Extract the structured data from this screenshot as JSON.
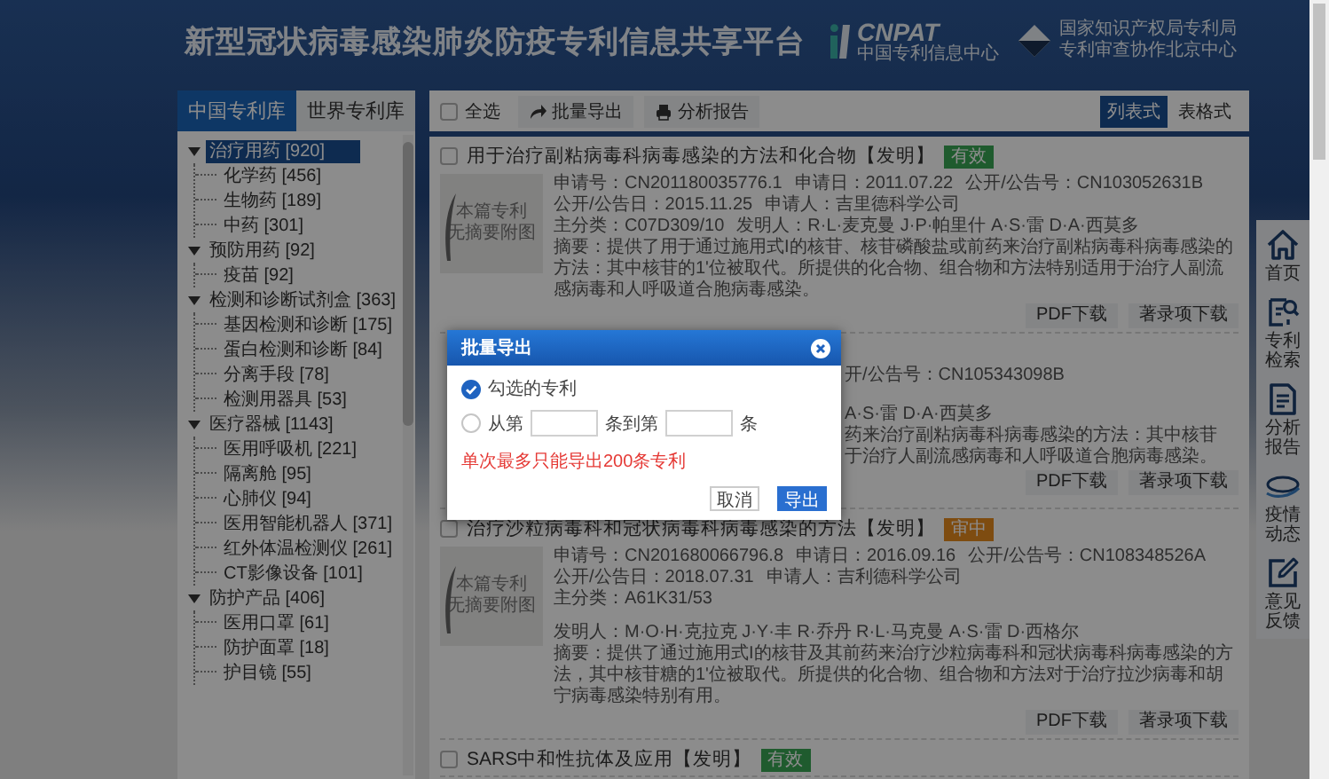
{
  "header": {
    "title": "新型冠状病毒感染肺炎防疫专利信息共享平台",
    "logos": [
      {
        "kind": "cnpat",
        "lines": [
          "CNPAT",
          "中国专利信息中心"
        ]
      },
      {
        "kind": "diamond",
        "lines": [
          "国家知识产权局专利局",
          "专利审查协作北京中心"
        ]
      }
    ]
  },
  "database_tabs": [
    {
      "label": "中国专利库",
      "selected": true
    },
    {
      "label": "世界专利库",
      "selected": false
    }
  ],
  "category_tree": [
    {
      "label": "治疗用药 [920]",
      "selected": true,
      "expanded": true,
      "children": [
        {
          "label": "化学药 [456]",
          "selected": false
        },
        {
          "label": "生物药 [189]",
          "selected": false
        },
        {
          "label": "中药 [301]",
          "selected": false
        }
      ]
    },
    {
      "label": "预防用药 [92]",
      "selected": false,
      "expanded": true,
      "children": [
        {
          "label": "疫苗 [92]",
          "selected": false
        }
      ]
    },
    {
      "label": "检测和诊断试剂盒 [363]",
      "selected": false,
      "expanded": true,
      "children": [
        {
          "label": "基因检测和诊断 [175]",
          "selected": false
        },
        {
          "label": "蛋白检测和诊断 [84]",
          "selected": false
        },
        {
          "label": "分离手段 [78]",
          "selected": false
        },
        {
          "label": "检测用器具 [53]",
          "selected": false
        }
      ]
    },
    {
      "label": "医疗器械 [1143]",
      "selected": false,
      "expanded": true,
      "children": [
        {
          "label": "医用呼吸机 [221]",
          "selected": false
        },
        {
          "label": "隔离舱 [95]",
          "selected": false
        },
        {
          "label": "心肺仪 [94]",
          "selected": false
        },
        {
          "label": "医用智能机器人 [371]",
          "selected": false
        },
        {
          "label": "红外体温检测仪 [261]",
          "selected": false
        },
        {
          "label": "CT影像设备 [101]",
          "selected": false
        }
      ]
    },
    {
      "label": "防护产品 [406]",
      "selected": false,
      "expanded": true,
      "children": [
        {
          "label": "医用口罩 [61]",
          "selected": false
        },
        {
          "label": "防护面罩 [18]",
          "selected": false
        },
        {
          "label": "护目镜 [55]",
          "selected": false
        }
      ]
    }
  ],
  "toolbar": {
    "select_all": {
      "label": "全选",
      "checked": false
    },
    "actions": [
      {
        "label": "批量导出",
        "kind": "export"
      },
      {
        "label": "分析报告",
        "kind": "report"
      }
    ],
    "views": [
      {
        "label": "列表式",
        "selected": true
      },
      {
        "label": "表格式",
        "selected": false
      }
    ]
  },
  "results": [
    {
      "kind": "record",
      "checked": false,
      "title": "用于治疗副粘病毒科病毒感染的方法和化合物【发明】",
      "status": {
        "label": "有效",
        "kind": "valid"
      },
      "thumbnail": [
        "本篇专利",
        "无摘要附图"
      ],
      "fields": [
        [
          "申请号：CN201180035776.1",
          "申请日：2011.07.22",
          "公开/公告号：CN103052631B"
        ],
        [
          "公开/公告日：2015.11.25",
          "申请人：吉里德科学公司"
        ],
        [
          "主分类：C07D309/10",
          "发明人：R·L·麦克曼 J·P·帕里什 A·S·雷 D·A·西莫多"
        ]
      ],
      "abstract": "摘要：提供了用于通过施用式I的核苷、核苷磷酸盐或前药来治疗副粘病毒科病毒感染的方法：其中核苷的1'位被取代。所提供的化合物、组合物和方法特别适用于治疗人副流感病毒和人呼吸道合胞病毒感染。",
      "buttons": [
        "PDF下载",
        "著录项下载"
      ]
    },
    {
      "kind": "partial",
      "fragments": [
        "开/公告号：CN105343098B",
        "A·S·雷 D·A·西莫多",
        "药来治疗副粘病毒科病毒感染的方法：其中核苷",
        "于治疗人副流感病毒和人呼吸道合胞病毒感染。"
      ],
      "buttons": [
        "PDF下载",
        "著录项下载"
      ]
    },
    {
      "kind": "record",
      "checked": false,
      "title": "治疗沙粒病毒科和冠状病毒科病毒感染的方法【发明】",
      "status": {
        "label": "审中",
        "kind": "pending"
      },
      "thumbnail": [
        "本篇专利",
        "无摘要附图"
      ],
      "fields": [
        [
          "申请号：CN201680066796.8",
          "申请日：2016.09.16",
          "公开/公告号：CN108348526A"
        ],
        [
          "公开/公告日：2018.07.31",
          "申请人：吉利德科学公司"
        ],
        [
          "主分类：A61K31/53",
          "发明人：M·O·H·克拉克 J·Y·丰 R·乔丹 R·L·马克曼 A·S·雷 D·西格尔"
        ]
      ],
      "abstract": "摘要：提供了通过施用式I的核苷及其前药来治疗沙粒病毒科和冠状病毒科病毒感染的方法，其中核苷糖的1'位被取代。所提供的化合物、组合物和方法对于治疗拉沙病毒和胡宁病毒感染特别有用。",
      "buttons": [
        "PDF下载",
        "著录项下载"
      ]
    },
    {
      "kind": "record",
      "checked": false,
      "title": "SARS中和性抗体及应用【发明】",
      "status": {
        "label": "有效",
        "kind": "valid"
      }
    }
  ],
  "dialog": {
    "title": "批量导出",
    "options": [
      {
        "kind": "checked",
        "label": "勾选的专利",
        "selected": true
      },
      {
        "kind": "range",
        "parts": [
          "从第",
          "条到第",
          "条"
        ],
        "selected": false
      }
    ],
    "warning": "单次最多只能导出200条专利",
    "buttons": [
      {
        "label": "取消",
        "kind": "secondary"
      },
      {
        "label": "导出",
        "kind": "primary"
      }
    ]
  },
  "side_nav": [
    {
      "label": "首页",
      "kind": "home"
    },
    {
      "label": "专利检索",
      "kind": "search"
    },
    {
      "label": "分析报告",
      "kind": "report"
    },
    {
      "label": "疫情动态",
      "kind": "news"
    },
    {
      "label": "意见反馈",
      "kind": "feedback"
    }
  ]
}
